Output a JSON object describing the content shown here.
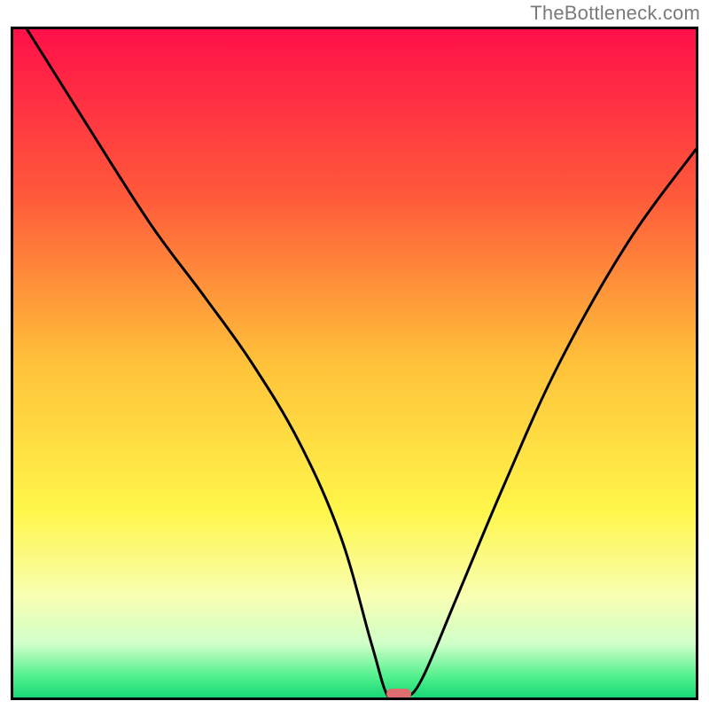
{
  "watermark": "TheBottleneck.com",
  "chart_data": {
    "type": "line",
    "title": "",
    "xlabel": "",
    "ylabel": "",
    "xlim": [
      0,
      100
    ],
    "ylim": [
      0,
      100
    ],
    "gradient_stops": [
      {
        "offset": 0,
        "color": "#ff1049"
      },
      {
        "offset": 25,
        "color": "#ff5a3a"
      },
      {
        "offset": 50,
        "color": "#ffc23a"
      },
      {
        "offset": 72,
        "color": "#fff64a"
      },
      {
        "offset": 85,
        "color": "#f8ffb3"
      },
      {
        "offset": 92,
        "color": "#cfffc8"
      },
      {
        "offset": 97,
        "color": "#4ef08b"
      },
      {
        "offset": 100,
        "color": "#18d877"
      }
    ],
    "series": [
      {
        "name": "bottleneck-curve",
        "x": [
          2,
          10,
          20,
          28,
          35,
          42,
          48,
          52.5,
          55,
          57.5,
          60,
          65,
          72,
          80,
          90,
          100
        ],
        "y": [
          100,
          87,
          71,
          60,
          50,
          38,
          24,
          8,
          0,
          0,
          3,
          15,
          32,
          50,
          68,
          82
        ]
      }
    ],
    "marker": {
      "x": 56.5,
      "y": 0,
      "color": "#dd6d6f"
    }
  }
}
